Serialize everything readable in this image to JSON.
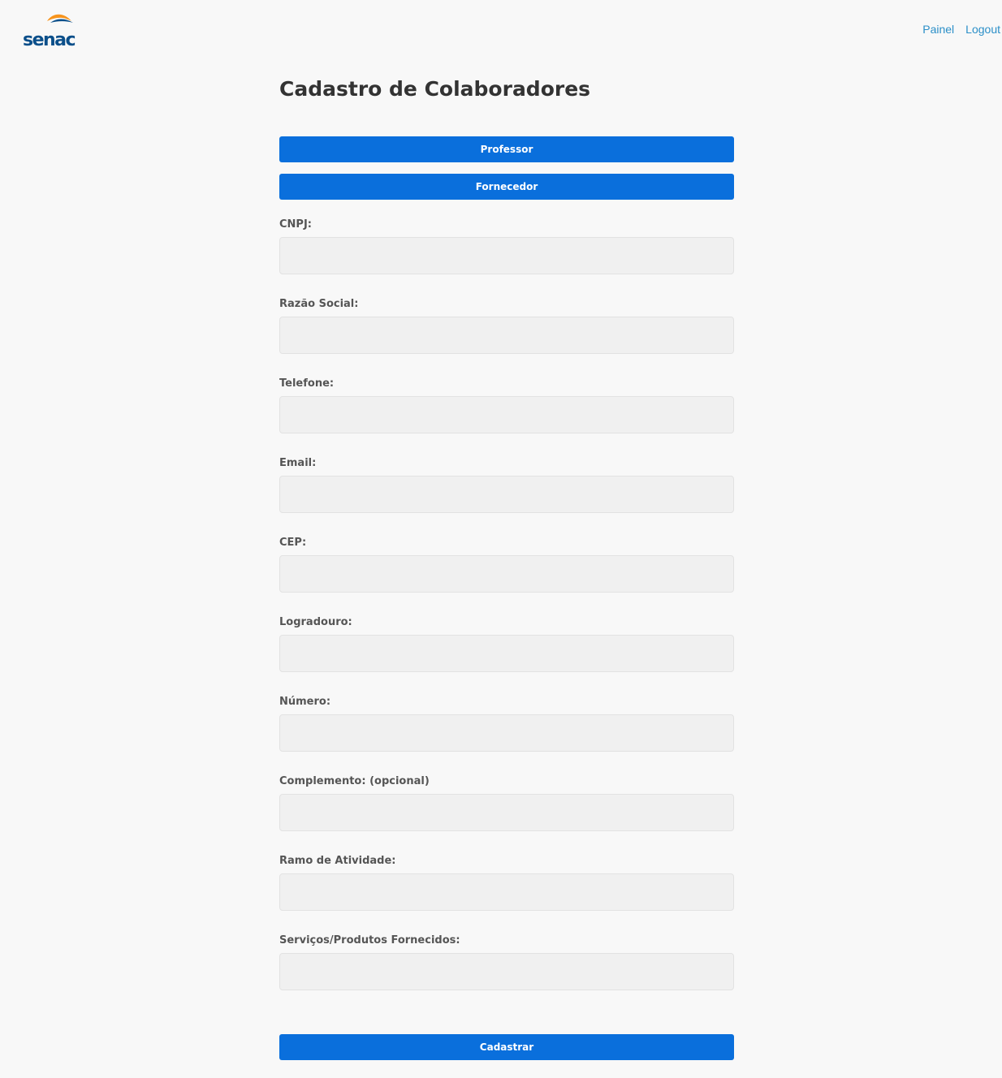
{
  "header": {
    "logo_text": "senac",
    "nav": [
      {
        "label": "Painel"
      },
      {
        "label": "Logout"
      }
    ],
    "colors": {
      "logo_blue": "#0b4f8a",
      "logo_orange": "#f7941d",
      "link": "#2b8fc8"
    }
  },
  "form": {
    "title": "Cadastro de Colaboradores",
    "type_buttons": {
      "professor": "Professor",
      "fornecedor": "Fornecedor"
    },
    "fields": [
      {
        "label": "CNPJ:",
        "value": ""
      },
      {
        "label": "Razão Social:",
        "value": ""
      },
      {
        "label": "Telefone:",
        "value": ""
      },
      {
        "label": "Email:",
        "value": ""
      },
      {
        "label": "CEP:",
        "value": ""
      },
      {
        "label": "Logradouro:",
        "value": ""
      },
      {
        "label": "Número:",
        "value": ""
      },
      {
        "label": "Complemento: (opcional)",
        "value": ""
      },
      {
        "label": "Ramo de Atividade:",
        "value": ""
      },
      {
        "label": "Serviços/Produtos Fornecidos:",
        "value": ""
      }
    ],
    "submit_label": "Cadastrar",
    "colors": {
      "button": "#0a6fdc",
      "input_bg": "#f0f0f0"
    }
  }
}
